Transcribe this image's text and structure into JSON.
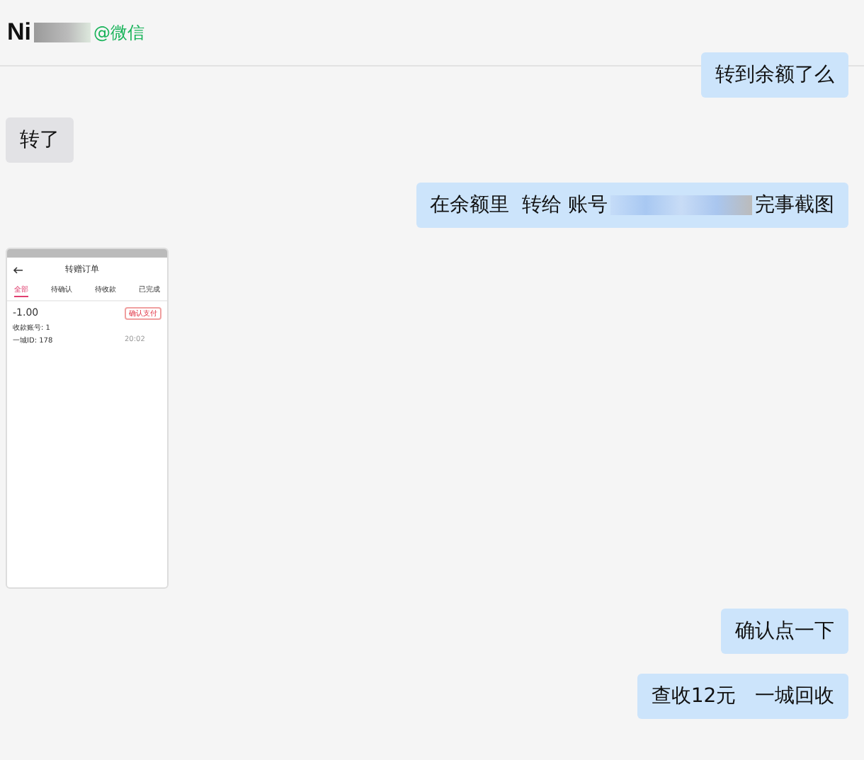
{
  "header": {
    "name": "Ni",
    "source": "@微信"
  },
  "messages": [
    {
      "kind": "text",
      "outgoing": true,
      "parts": [
        "转到余额了么"
      ]
    },
    {
      "kind": "text",
      "outgoing": false,
      "parts": [
        "转了"
      ]
    },
    {
      "kind": "text",
      "outgoing": true,
      "parts": [
        "在余额里  转给 账号",
        "完事截图"
      ]
    },
    {
      "kind": "image",
      "outgoing": false,
      "screenshot": {
        "title": "转赠订单",
        "tabs": [
          {
            "label": "全部",
            "selected": true
          },
          {
            "label": "待确认",
            "selected": false
          },
          {
            "label": "待收款",
            "selected": false
          },
          {
            "label": "已完成",
            "selected": false
          }
        ],
        "order": {
          "amount": "-1.00",
          "action": "确认支付",
          "account": "收款账号: 1",
          "id": "一城ID: 178",
          "time": "20:02"
        }
      }
    },
    {
      "kind": "text",
      "outgoing": true,
      "parts": [
        "确认点一下"
      ]
    },
    {
      "kind": "text",
      "outgoing": true,
      "parts": [
        "查收12元   一城回收"
      ]
    }
  ]
}
